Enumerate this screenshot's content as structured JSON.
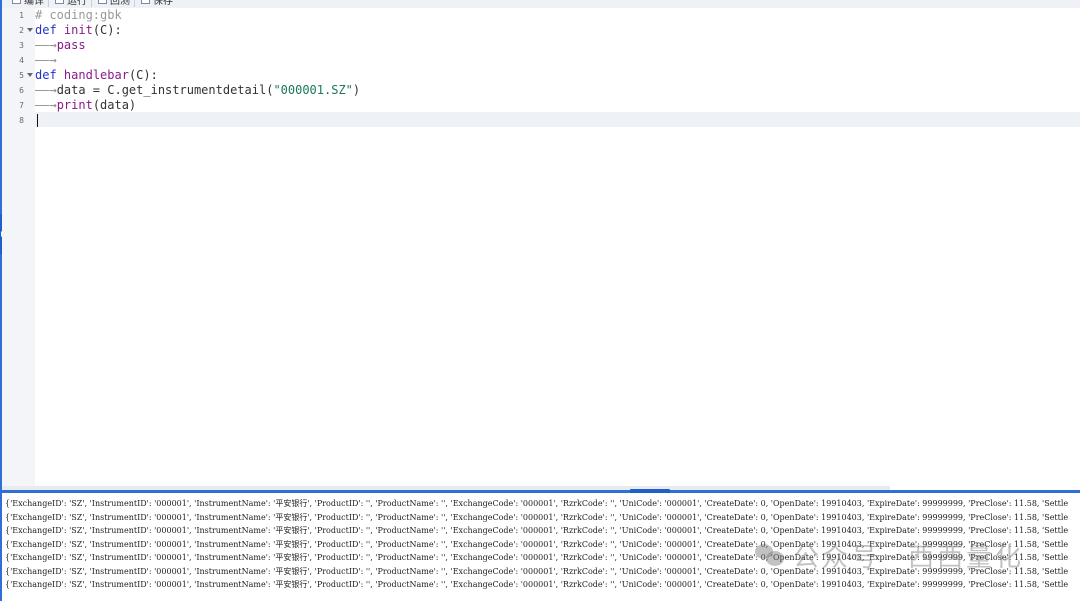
{
  "toolbar": {
    "items": [
      {
        "icon": "edit-icon",
        "label": "编译"
      },
      {
        "icon": "run-icon",
        "label": "运行"
      },
      {
        "icon": "chart-icon",
        "label": "回测"
      },
      {
        "icon": "save-icon",
        "label": "保存"
      }
    ]
  },
  "editor": {
    "line_numbers": [
      "1",
      "2",
      "3",
      "4",
      "5",
      "6",
      "7",
      "8"
    ],
    "current_line": 8,
    "lines": {
      "l1": {
        "text": "# coding:gbk"
      },
      "l2": {
        "kw": "def",
        "fn": "init",
        "rest": "(C):"
      },
      "l3": {
        "indent": "——→",
        "text": "pass"
      },
      "l4": {
        "indent": "——→"
      },
      "l5": {
        "kw": "def",
        "fn": "handlebar",
        "rest": "(C):"
      },
      "l6": {
        "indent": "——→",
        "code": "data = C.get_instrumentdetail(",
        "str": "\"000001.SZ\"",
        "close": ")"
      },
      "l7": {
        "indent": "——→",
        "fn": "print",
        "rest": "(data)"
      }
    }
  },
  "output": {
    "lines": [
      "{'ExchangeID': 'SZ', 'InstrumentID': '000001', 'InstrumentName': '平安银行', 'ProductID': '', 'ProductName': '', 'ExchangeCode': '000001', 'RzrkCode': '', 'UniCode': '000001', 'CreateDate': 0, 'OpenDate': 19910403, 'ExpireDate': 99999999, 'PreClose': 11.58, 'Settle",
      "{'ExchangeID': 'SZ', 'InstrumentID': '000001', 'InstrumentName': '平安银行', 'ProductID': '', 'ProductName': '', 'ExchangeCode': '000001', 'RzrkCode': '', 'UniCode': '000001', 'CreateDate': 0, 'OpenDate': 19910403, 'ExpireDate': 99999999, 'PreClose': 11.58, 'Settle",
      "{'ExchangeID': 'SZ', 'InstrumentID': '000001', 'InstrumentName': '平安银行', 'ProductID': '', 'ProductName': '', 'ExchangeCode': '000001', 'RzrkCode': '', 'UniCode': '000001', 'CreateDate': 0, 'OpenDate': 19910403, 'ExpireDate': 99999999, 'PreClose': 11.58, 'Settle",
      "{'ExchangeID': 'SZ', 'InstrumentID': '000001', 'InstrumentName': '平安银行', 'ProductID': '', 'ProductName': '', 'ExchangeCode': '000001', 'RzrkCode': '', 'UniCode': '000001', 'CreateDate': 0, 'OpenDate': 19910403, 'ExpireDate': 99999999, 'PreClose': 11.58, 'Settle",
      "{'ExchangeID': 'SZ', 'InstrumentID': '000001', 'InstrumentName': '平安银行', 'ProductID': '', 'ProductName': '', 'ExchangeCode': '000001', 'RzrkCode': '', 'UniCode': '000001', 'CreateDate': 0, 'OpenDate': 19910403, 'ExpireDate': 99999999, 'PreClose': 11.58, 'Settle",
      "{'ExchangeID': 'SZ', 'InstrumentID': '000001', 'InstrumentName': '平安银行', 'ProductID': '', 'ProductName': '', 'ExchangeCode': '000001', 'RzrkCode': '', 'UniCode': '000001', 'CreateDate': 0, 'OpenDate': 19910403, 'ExpireDate': 99999999, 'PreClose': 11.58, 'Settle",
      "{'ExchangeID': 'SZ', 'InstrumentID': '000001', 'InstrumentName': '平安银行', 'ProductID': '', 'ProductName': '', 'ExchangeCode': '000001', 'RzrkCode': '', 'UniCode': '000001', 'CreateDate': 0, 'OpenDate': 19910403, 'ExpireDate': 99999999, 'PreClose': 11.58, 'Settle"
    ]
  },
  "watermark": {
    "left": "公众号",
    "right": "西西量化"
  }
}
